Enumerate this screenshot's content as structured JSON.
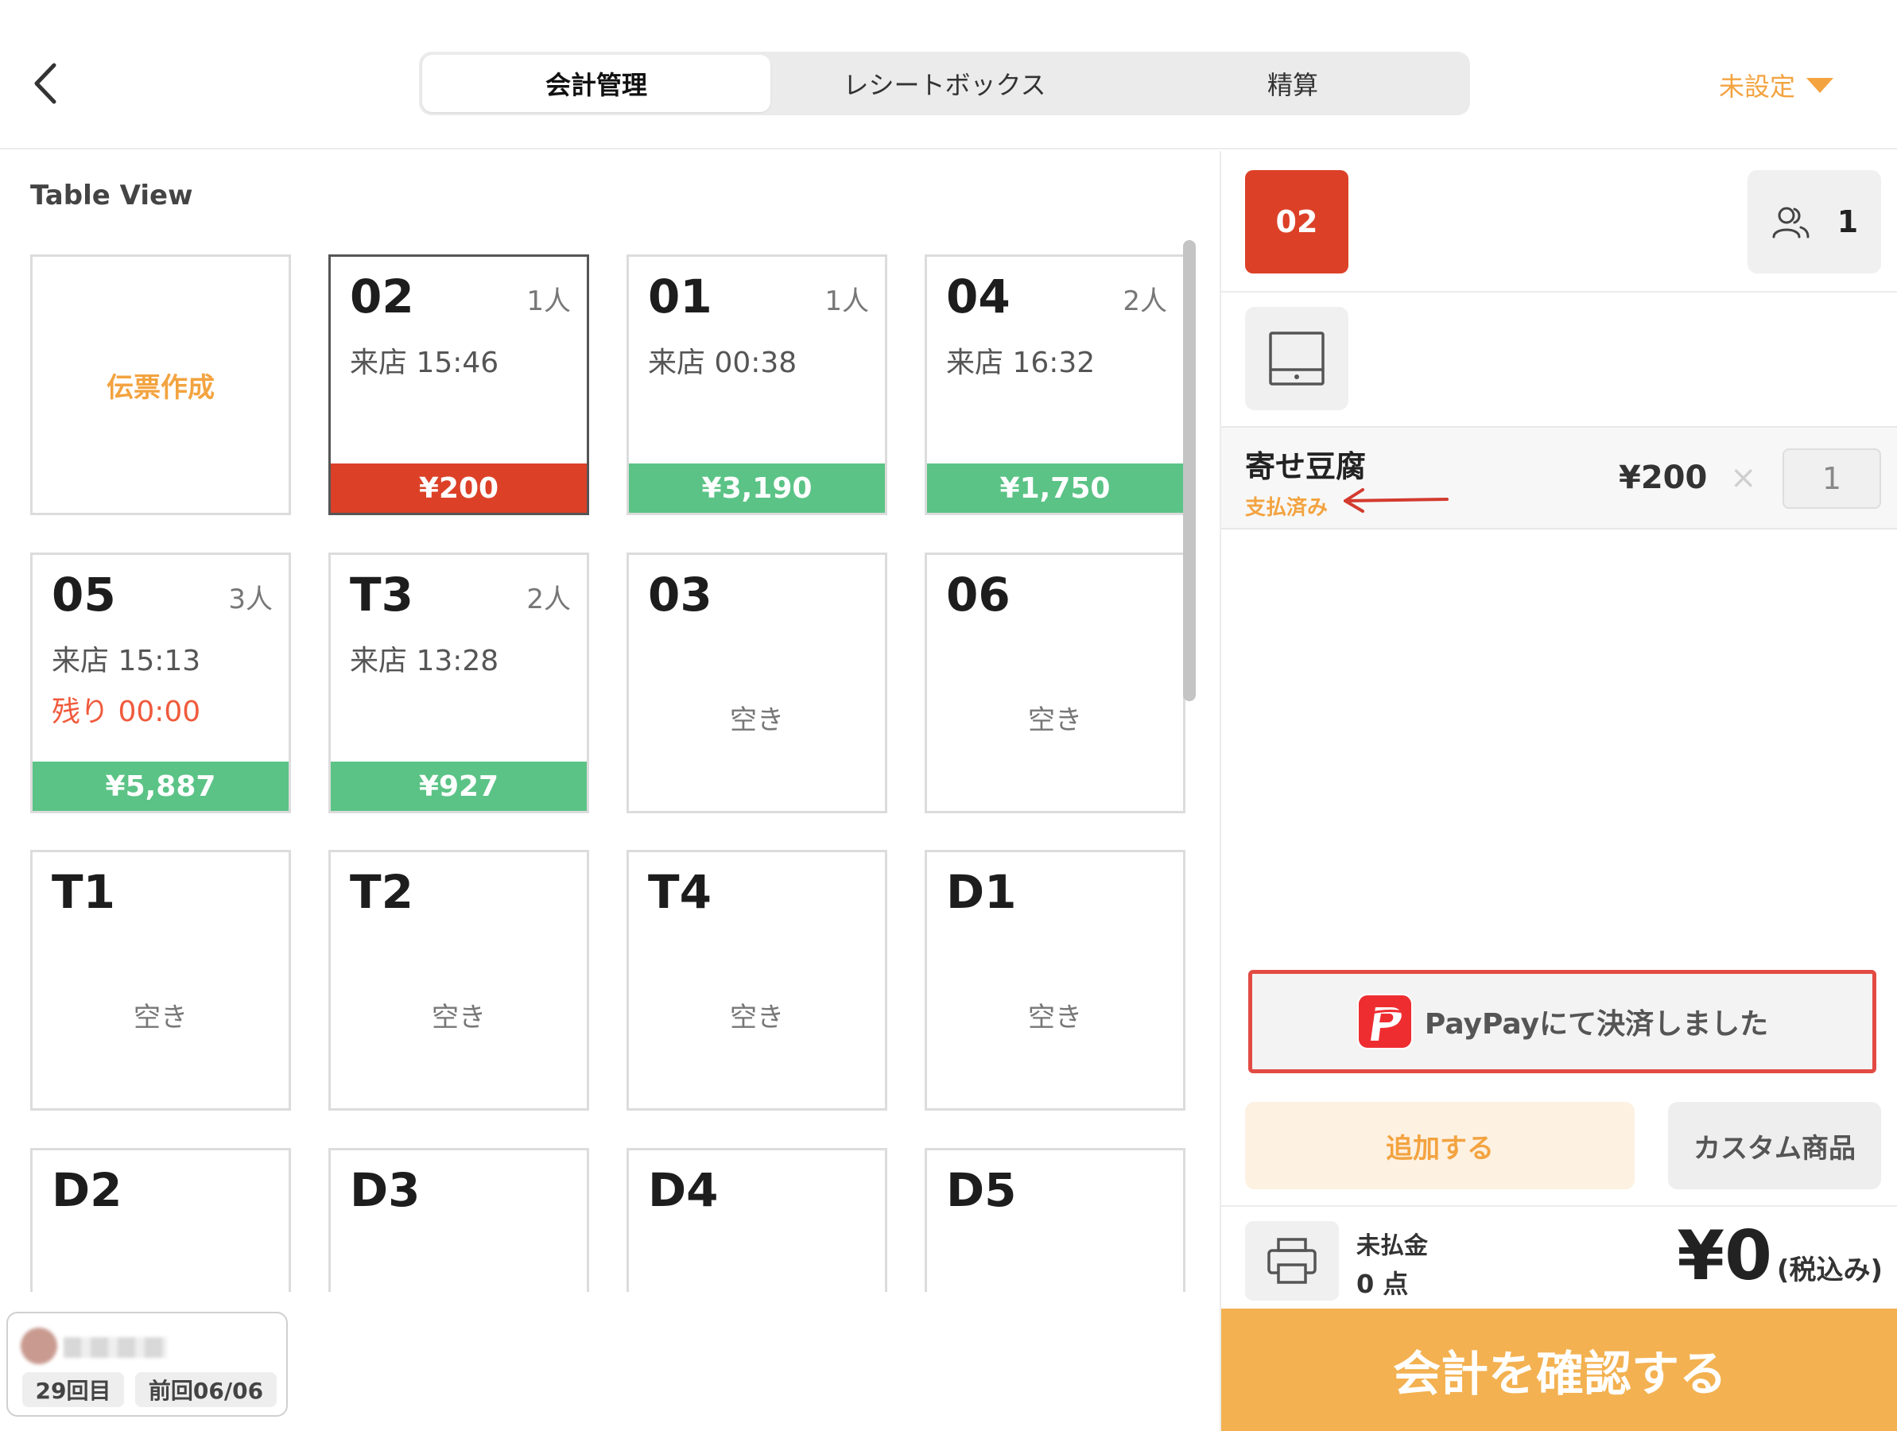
{
  "header": {
    "tabs": [
      {
        "label": "会計管理",
        "active": true
      },
      {
        "label": "レシートボックス",
        "active": false
      },
      {
        "label": "精算",
        "active": false
      }
    ],
    "status_dropdown": "未設定"
  },
  "left": {
    "section_title": "Table View",
    "new_slip_label": "伝票作成",
    "tables": [
      {
        "name": "02",
        "guests": "1人",
        "visit": "来店 15:46",
        "amount": "¥200",
        "amount_color": "red",
        "selected": true
      },
      {
        "name": "01",
        "guests": "1人",
        "visit": "来店 00:38",
        "amount": "¥3,190",
        "amount_color": "green"
      },
      {
        "name": "04",
        "guests": "2人",
        "visit": "来店 16:32",
        "amount": "¥1,750",
        "amount_color": "green"
      },
      {
        "name": "05",
        "guests": "3人",
        "visit": "来店 15:13",
        "remaining": "残り 00:00",
        "amount": "¥5,887",
        "amount_color": "green"
      },
      {
        "name": "T3",
        "guests": "2人",
        "visit": "来店 13:28",
        "amount": "¥927",
        "amount_color": "green"
      },
      {
        "name": "03",
        "status": "空き"
      },
      {
        "name": "06",
        "status": "空き"
      },
      {
        "name": "T1",
        "status": "空き"
      },
      {
        "name": "T2",
        "status": "空き"
      },
      {
        "name": "T4",
        "status": "空き"
      },
      {
        "name": "D1",
        "status": "空き"
      },
      {
        "name": "D2"
      },
      {
        "name": "D3"
      },
      {
        "name": "D4"
      },
      {
        "name": "D5"
      }
    ],
    "customer": {
      "visits": "29回目",
      "last_visit": "前回06/06"
    }
  },
  "right": {
    "table_badge": "02",
    "guest_count": "1",
    "order_items": [
      {
        "name": "寄せ豆腐",
        "status": "支払済み",
        "price": "¥200",
        "times": "×",
        "qty": "1"
      }
    ],
    "paypay_label": "PayPayにて決済しました",
    "add_label": "追加する",
    "custom_label": "カスタム商品",
    "unpaid_label": "未払金",
    "points": "0 点",
    "total": "¥0",
    "tax_note": "(税込み)",
    "confirm_label": "会計を確認する"
  },
  "colors": {
    "accent": "#f3a340",
    "red": "#dc4128",
    "green": "#5bc386",
    "confirm": "#f3b151",
    "highlight_border": "#e24b43"
  },
  "icons": [
    "chevron-left-icon",
    "people-icon",
    "tablet-icon",
    "arrow-left-icon",
    "paypay-icon",
    "printer-icon",
    "caret-down-icon"
  ]
}
